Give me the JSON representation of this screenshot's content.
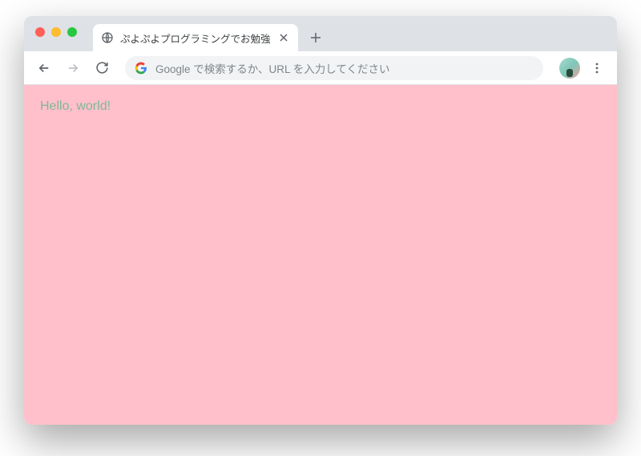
{
  "tab": {
    "title": "ぷよぷよプログラミングでお勉強"
  },
  "omnibox": {
    "placeholder": "Google で検索するか、URL を入力してください"
  },
  "content": {
    "hello_text": "Hello, world!",
    "background_color": "#ffc0cb",
    "text_color": "#7fb896"
  }
}
